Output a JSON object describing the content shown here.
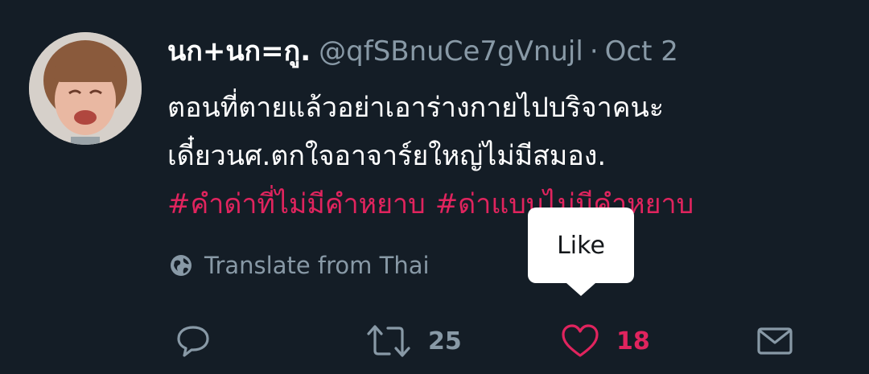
{
  "tweet": {
    "display_name": "นก+นก=กู.",
    "handle": "@qfSBnuCe7gVnujl",
    "separator": "·",
    "date": "Oct 2",
    "body_lines": [
      "ตอนที่ตายแล้วอย่าเอาร่างกายไปบริจาคนะ",
      "เดี๋ยวนศ.ตกใจอาจาร์ยใหญ่ไม่มีสมอง."
    ],
    "hashtags": [
      "#คำด่าที่ไม่มีคำหยาบ",
      "#ด่าแบบไม่มีคำหยาบ"
    ],
    "translate_label": "Translate from Thai",
    "tooltip_label": "Like",
    "actions": {
      "reply": {
        "icon": "reply-icon"
      },
      "retweet": {
        "icon": "retweet-icon",
        "count": "25"
      },
      "like": {
        "icon": "heart-icon",
        "count": "18",
        "active_color": "#e0245e"
      },
      "dm": {
        "icon": "envelope-icon"
      }
    }
  },
  "colors": {
    "background": "#141d26",
    "secondary_text": "#8899a6",
    "accent": "#e0245e",
    "tooltip_bg": "#ffffff"
  }
}
